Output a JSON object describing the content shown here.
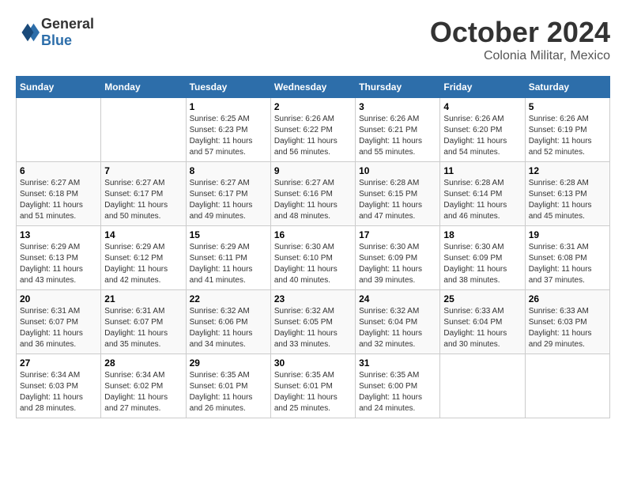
{
  "header": {
    "logo_line1": "General",
    "logo_line2": "Blue",
    "month_title": "October 2024",
    "subtitle": "Colonia Militar, Mexico"
  },
  "weekdays": [
    "Sunday",
    "Monday",
    "Tuesday",
    "Wednesday",
    "Thursday",
    "Friday",
    "Saturday"
  ],
  "weeks": [
    [
      {
        "day": "",
        "sunrise": "",
        "sunset": "",
        "daylight": ""
      },
      {
        "day": "",
        "sunrise": "",
        "sunset": "",
        "daylight": ""
      },
      {
        "day": "1",
        "sunrise": "Sunrise: 6:25 AM",
        "sunset": "Sunset: 6:23 PM",
        "daylight": "Daylight: 11 hours and 57 minutes."
      },
      {
        "day": "2",
        "sunrise": "Sunrise: 6:26 AM",
        "sunset": "Sunset: 6:22 PM",
        "daylight": "Daylight: 11 hours and 56 minutes."
      },
      {
        "day": "3",
        "sunrise": "Sunrise: 6:26 AM",
        "sunset": "Sunset: 6:21 PM",
        "daylight": "Daylight: 11 hours and 55 minutes."
      },
      {
        "day": "4",
        "sunrise": "Sunrise: 6:26 AM",
        "sunset": "Sunset: 6:20 PM",
        "daylight": "Daylight: 11 hours and 54 minutes."
      },
      {
        "day": "5",
        "sunrise": "Sunrise: 6:26 AM",
        "sunset": "Sunset: 6:19 PM",
        "daylight": "Daylight: 11 hours and 52 minutes."
      }
    ],
    [
      {
        "day": "6",
        "sunrise": "Sunrise: 6:27 AM",
        "sunset": "Sunset: 6:18 PM",
        "daylight": "Daylight: 11 hours and 51 minutes."
      },
      {
        "day": "7",
        "sunrise": "Sunrise: 6:27 AM",
        "sunset": "Sunset: 6:17 PM",
        "daylight": "Daylight: 11 hours and 50 minutes."
      },
      {
        "day": "8",
        "sunrise": "Sunrise: 6:27 AM",
        "sunset": "Sunset: 6:17 PM",
        "daylight": "Daylight: 11 hours and 49 minutes."
      },
      {
        "day": "9",
        "sunrise": "Sunrise: 6:27 AM",
        "sunset": "Sunset: 6:16 PM",
        "daylight": "Daylight: 11 hours and 48 minutes."
      },
      {
        "day": "10",
        "sunrise": "Sunrise: 6:28 AM",
        "sunset": "Sunset: 6:15 PM",
        "daylight": "Daylight: 11 hours and 47 minutes."
      },
      {
        "day": "11",
        "sunrise": "Sunrise: 6:28 AM",
        "sunset": "Sunset: 6:14 PM",
        "daylight": "Daylight: 11 hours and 46 minutes."
      },
      {
        "day": "12",
        "sunrise": "Sunrise: 6:28 AM",
        "sunset": "Sunset: 6:13 PM",
        "daylight": "Daylight: 11 hours and 45 minutes."
      }
    ],
    [
      {
        "day": "13",
        "sunrise": "Sunrise: 6:29 AM",
        "sunset": "Sunset: 6:13 PM",
        "daylight": "Daylight: 11 hours and 43 minutes."
      },
      {
        "day": "14",
        "sunrise": "Sunrise: 6:29 AM",
        "sunset": "Sunset: 6:12 PM",
        "daylight": "Daylight: 11 hours and 42 minutes."
      },
      {
        "day": "15",
        "sunrise": "Sunrise: 6:29 AM",
        "sunset": "Sunset: 6:11 PM",
        "daylight": "Daylight: 11 hours and 41 minutes."
      },
      {
        "day": "16",
        "sunrise": "Sunrise: 6:30 AM",
        "sunset": "Sunset: 6:10 PM",
        "daylight": "Daylight: 11 hours and 40 minutes."
      },
      {
        "day": "17",
        "sunrise": "Sunrise: 6:30 AM",
        "sunset": "Sunset: 6:09 PM",
        "daylight": "Daylight: 11 hours and 39 minutes."
      },
      {
        "day": "18",
        "sunrise": "Sunrise: 6:30 AM",
        "sunset": "Sunset: 6:09 PM",
        "daylight": "Daylight: 11 hours and 38 minutes."
      },
      {
        "day": "19",
        "sunrise": "Sunrise: 6:31 AM",
        "sunset": "Sunset: 6:08 PM",
        "daylight": "Daylight: 11 hours and 37 minutes."
      }
    ],
    [
      {
        "day": "20",
        "sunrise": "Sunrise: 6:31 AM",
        "sunset": "Sunset: 6:07 PM",
        "daylight": "Daylight: 11 hours and 36 minutes."
      },
      {
        "day": "21",
        "sunrise": "Sunrise: 6:31 AM",
        "sunset": "Sunset: 6:07 PM",
        "daylight": "Daylight: 11 hours and 35 minutes."
      },
      {
        "day": "22",
        "sunrise": "Sunrise: 6:32 AM",
        "sunset": "Sunset: 6:06 PM",
        "daylight": "Daylight: 11 hours and 34 minutes."
      },
      {
        "day": "23",
        "sunrise": "Sunrise: 6:32 AM",
        "sunset": "Sunset: 6:05 PM",
        "daylight": "Daylight: 11 hours and 33 minutes."
      },
      {
        "day": "24",
        "sunrise": "Sunrise: 6:32 AM",
        "sunset": "Sunset: 6:04 PM",
        "daylight": "Daylight: 11 hours and 32 minutes."
      },
      {
        "day": "25",
        "sunrise": "Sunrise: 6:33 AM",
        "sunset": "Sunset: 6:04 PM",
        "daylight": "Daylight: 11 hours and 30 minutes."
      },
      {
        "day": "26",
        "sunrise": "Sunrise: 6:33 AM",
        "sunset": "Sunset: 6:03 PM",
        "daylight": "Daylight: 11 hours and 29 minutes."
      }
    ],
    [
      {
        "day": "27",
        "sunrise": "Sunrise: 6:34 AM",
        "sunset": "Sunset: 6:03 PM",
        "daylight": "Daylight: 11 hours and 28 minutes."
      },
      {
        "day": "28",
        "sunrise": "Sunrise: 6:34 AM",
        "sunset": "Sunset: 6:02 PM",
        "daylight": "Daylight: 11 hours and 27 minutes."
      },
      {
        "day": "29",
        "sunrise": "Sunrise: 6:35 AM",
        "sunset": "Sunset: 6:01 PM",
        "daylight": "Daylight: 11 hours and 26 minutes."
      },
      {
        "day": "30",
        "sunrise": "Sunrise: 6:35 AM",
        "sunset": "Sunset: 6:01 PM",
        "daylight": "Daylight: 11 hours and 25 minutes."
      },
      {
        "day": "31",
        "sunrise": "Sunrise: 6:35 AM",
        "sunset": "Sunset: 6:00 PM",
        "daylight": "Daylight: 11 hours and 24 minutes."
      },
      {
        "day": "",
        "sunrise": "",
        "sunset": "",
        "daylight": ""
      },
      {
        "day": "",
        "sunrise": "",
        "sunset": "",
        "daylight": ""
      }
    ]
  ]
}
